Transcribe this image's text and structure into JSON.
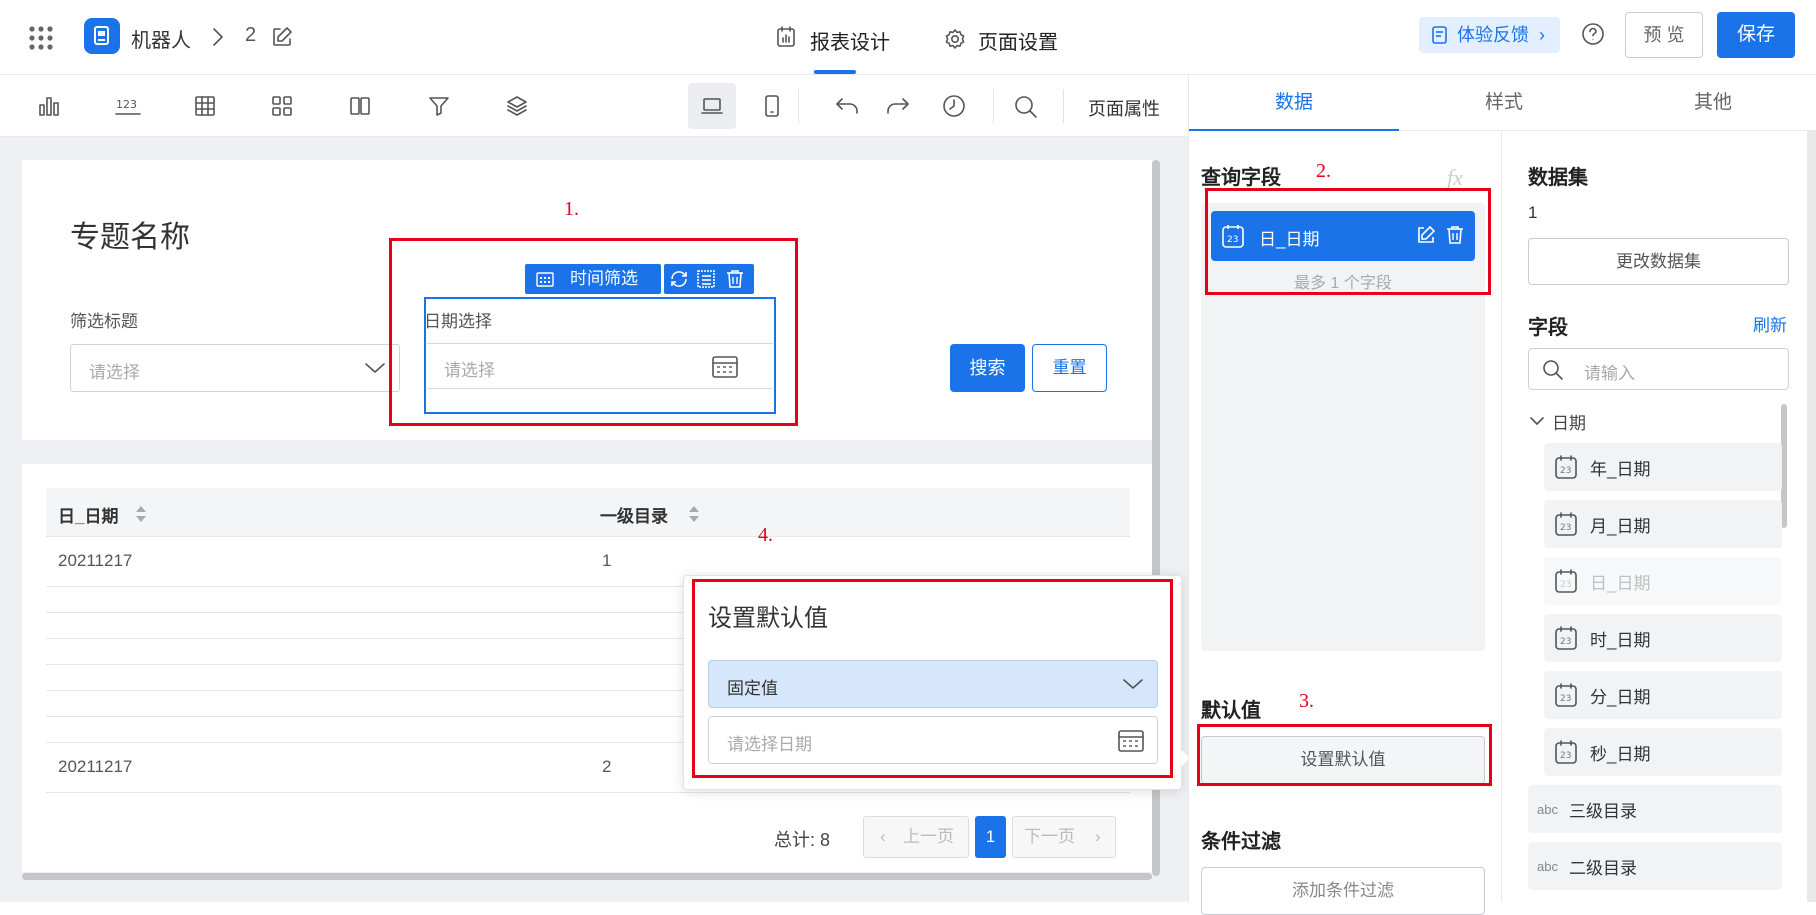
{
  "header": {
    "app_name": "机器人",
    "page_number": "2",
    "tabs": [
      {
        "label": "报表设计"
      },
      {
        "label": "页面设置"
      }
    ],
    "feedback_label": "体验反馈",
    "preview_label": "预 览",
    "save_label": "保存"
  },
  "toolbar": {
    "page_props_label": "页面属性"
  },
  "report": {
    "title": "专题名称",
    "filter1": {
      "label": "筛选标题",
      "placeholder": "请选择"
    },
    "filter2": {
      "label": "日期选择",
      "placeholder": "请选择",
      "widget_label": "时间筛选"
    },
    "search_label": "搜索",
    "reset_label": "重置",
    "table": {
      "columns": [
        "日_日期",
        "一级目录"
      ],
      "rows": [
        [
          "20211217",
          "1"
        ],
        [
          "",
          ""
        ],
        [
          "",
          ""
        ],
        [
          "",
          ""
        ],
        [
          "",
          ""
        ],
        [
          "",
          ""
        ],
        [
          "",
          ""
        ],
        [
          "20211217",
          "2"
        ]
      ]
    },
    "pagination": {
      "total_label": "总计: 8",
      "prev_label": "上一页",
      "current_page": "1",
      "next_label": "下一页"
    }
  },
  "popup": {
    "title": "设置默认值",
    "select_value": "固定值",
    "date_placeholder": "请选择日期"
  },
  "annotations": {
    "n1": "1.",
    "n2": "2.",
    "n3": "3.",
    "n4": "4."
  },
  "right_tabs": [
    {
      "label": "数据"
    },
    {
      "label": "样式"
    },
    {
      "label": "其他"
    }
  ],
  "query": {
    "title": "查询字段",
    "fx_label": "fx",
    "selected_field": "日_日期",
    "max_hint": "最多 1 个字段",
    "default_title": "默认值",
    "set_default_label": "设置默认值",
    "condition_title": "条件过滤",
    "add_condition_label": "添加条件过滤"
  },
  "dataset": {
    "title": "数据集",
    "value": "1",
    "change_label": "更改数据集",
    "fields_title": "字段",
    "refresh_label": "刷新",
    "search_placeholder": "请输入",
    "group_label": "日期",
    "date_fields": [
      "年_日期",
      "月_日期",
      "日_日期",
      "时_日期",
      "分_日期",
      "秒_日期"
    ],
    "text_fields": [
      "三级目录",
      "二级目录"
    ],
    "text_type_label": "abc"
  },
  "colors": {
    "primary": "#1a73e8",
    "highlight": "#e5001a",
    "feedback_bg": "#e3efff"
  }
}
